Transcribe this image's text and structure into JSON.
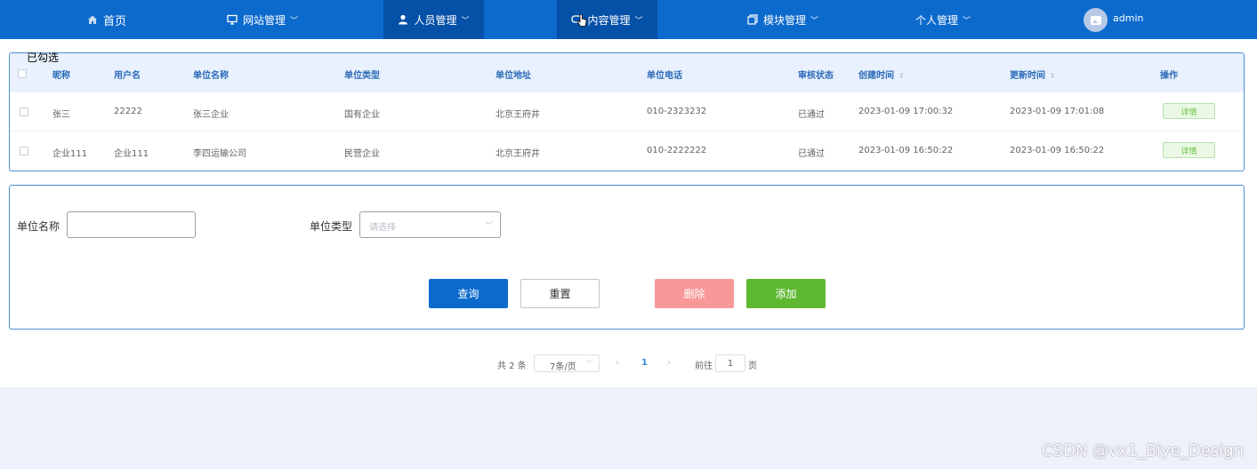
{
  "nav": {
    "home": "首页",
    "website": "网站管理",
    "people": "人员管理",
    "content": "内容管理",
    "module": "模块管理",
    "personal": "个人管理",
    "user": "admin"
  },
  "tag_text": "已勾选",
  "table": {
    "headers": [
      "昵称",
      "用户名",
      "单位名称",
      "单位类型",
      "单位地址",
      "单位电话",
      "审核状态",
      "创建时间",
      "更新时间",
      "操作"
    ],
    "rows": [
      {
        "nick": "张三",
        "username": "22222",
        "unit": "张三企业",
        "type": "国有企业",
        "address": "北京王府井",
        "phone": "010-2323232",
        "status": "已通过",
        "created": "2023-01-09 17:00:32",
        "updated": "2023-01-09 17:01:08",
        "action": "详情"
      },
      {
        "nick": "企业111",
        "username": "企业111",
        "unit": "李四运输公司",
        "type": "民营企业",
        "address": "北京王府井",
        "phone": "010-2222222",
        "status": "已通过",
        "created": "2023-01-09 16:50:22",
        "updated": "2023-01-09 16:50:22",
        "action": "详情"
      }
    ]
  },
  "search": {
    "unit_name_label": "单位名称",
    "unit_type_label": "单位类型",
    "unit_type_placeholder": "请选择",
    "query": "查询",
    "reset": "重置",
    "delete": "删除",
    "add": "添加"
  },
  "pagination": {
    "total": "共 2 条",
    "page_size": "7条/页",
    "current": "1",
    "goto_prefix": "前往",
    "goto_value": "1",
    "goto_suffix": "页"
  },
  "watermark": "CSDN @vx1_Biye_Design",
  "colors": {
    "nav": "#0c6acd",
    "nav_active": "#0551a8",
    "primary": "#0c6acd",
    "danger": "#f89898",
    "success": "#5fb832"
  }
}
